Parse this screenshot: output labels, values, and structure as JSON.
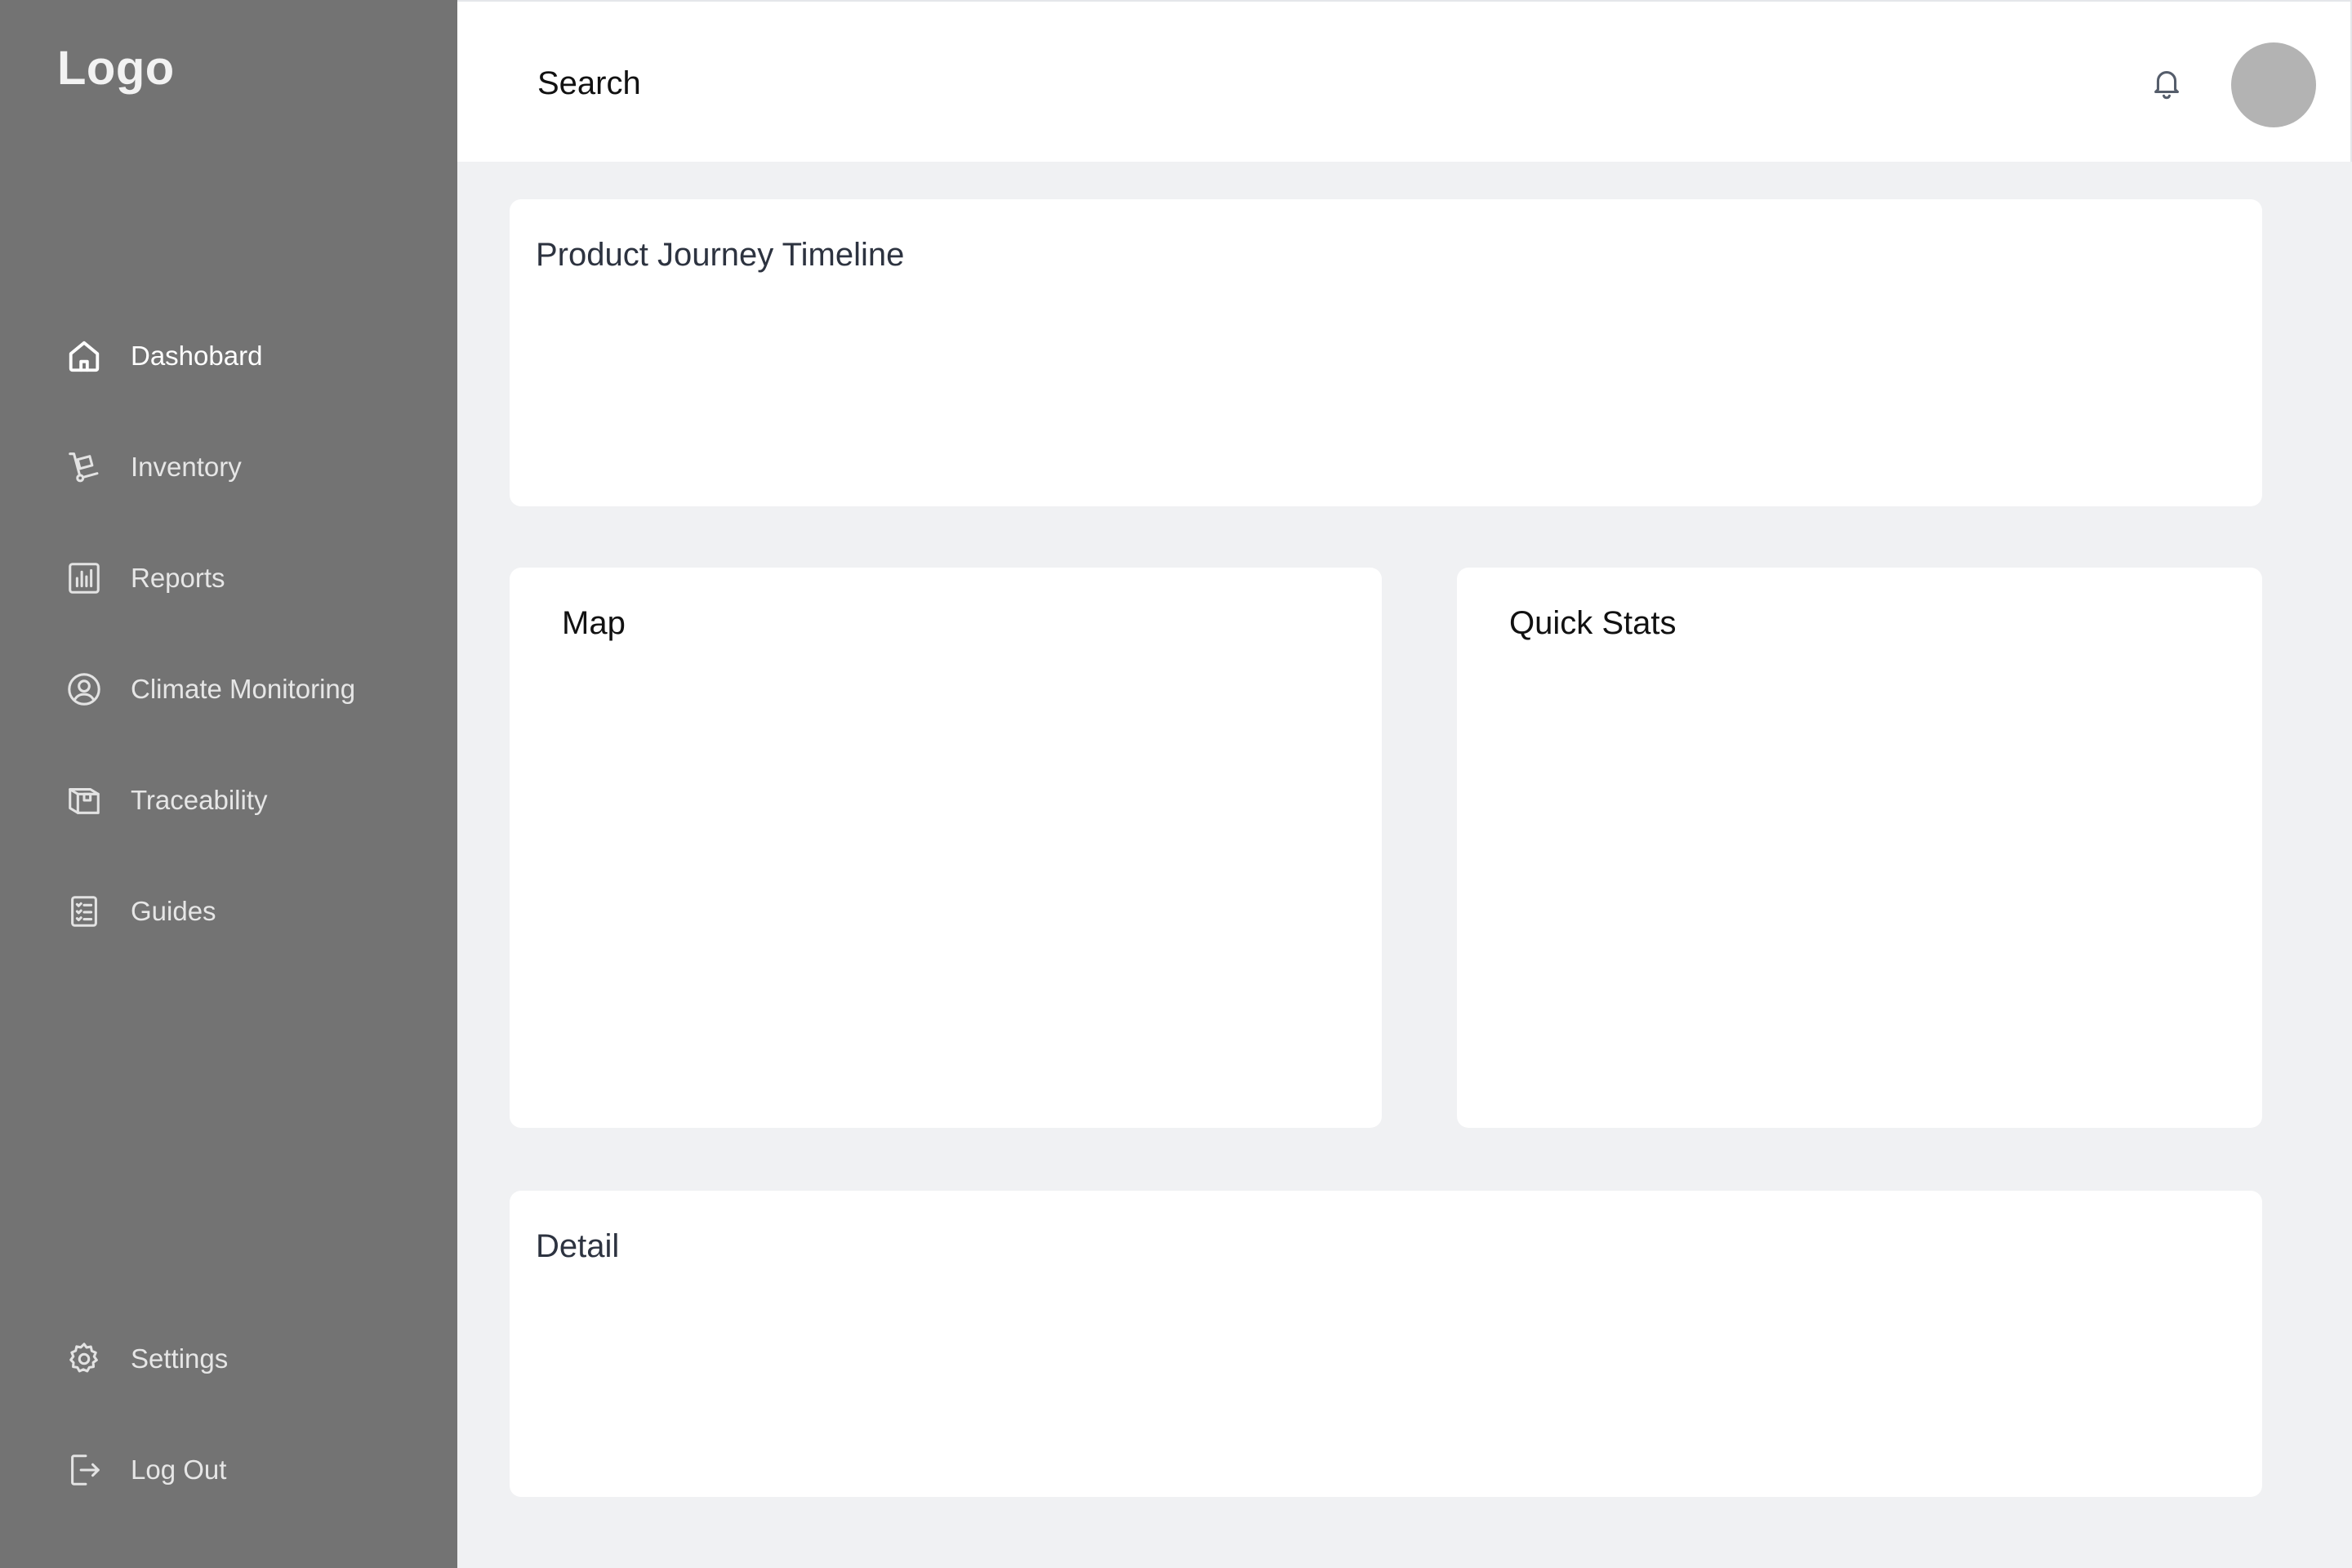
{
  "app": {
    "logo_text": "Logo"
  },
  "sidebar": {
    "items": [
      {
        "label": "Dashobard",
        "icon": "home-icon",
        "active": true
      },
      {
        "label": "Inventory",
        "icon": "hand-truck-icon",
        "active": false
      },
      {
        "label": "Reports",
        "icon": "bar-chart-icon",
        "active": false
      },
      {
        "label": "Climate Monitoring",
        "icon": "user-circle-icon",
        "active": false
      },
      {
        "label": "Traceability",
        "icon": "package-icon",
        "active": false
      },
      {
        "label": "Guides",
        "icon": "checklist-icon",
        "active": false
      }
    ],
    "bottom_items": [
      {
        "label": "Settings",
        "icon": "gear-icon"
      },
      {
        "label": "Log Out",
        "icon": "logout-icon"
      }
    ]
  },
  "header": {
    "search_placeholder": "Search",
    "notification_icon": "bell-icon"
  },
  "cards": {
    "timeline_title": "Product Journey Timeline",
    "map_title": "Map",
    "stats_title": "Quick Stats",
    "detail_title": "Detail"
  },
  "colors": {
    "sidebar_bg": "#737373",
    "page_bg": "#f0f1f3",
    "card_bg": "#ffffff",
    "avatar_bg": "#b3b3b3"
  }
}
